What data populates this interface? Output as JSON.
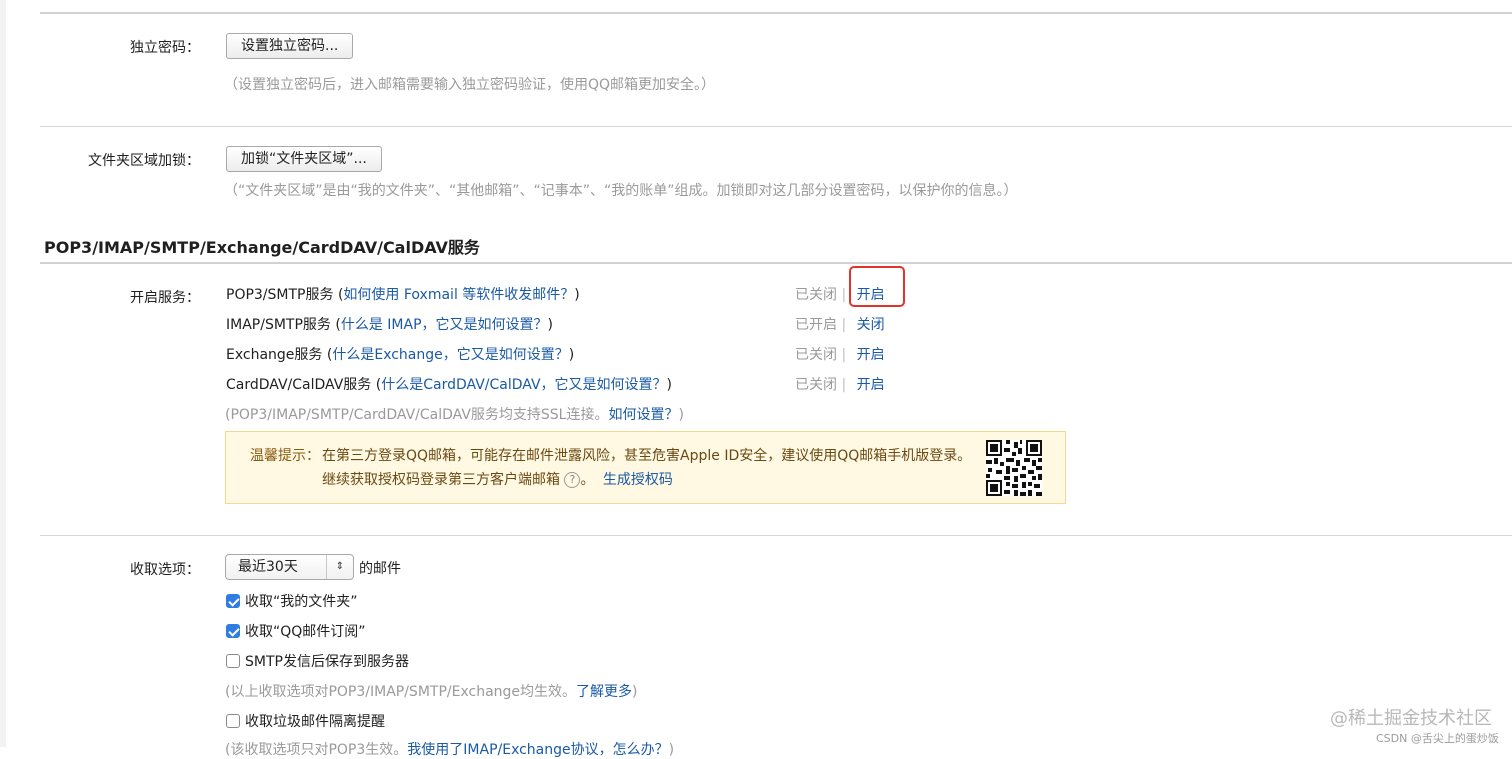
{
  "independent_password": {
    "label": "独立密码：",
    "button": "设置独立密码...",
    "hint": "（设置独立密码后，进入邮箱需要输入独立密码验证，使用QQ邮箱更加安全。）"
  },
  "folder_lock": {
    "label": "文件夹区域加锁：",
    "button": "加锁“文件夹区域”...",
    "hint": "（“文件夹区域”是由“我的文件夹”、“其他邮箱”、“记事本”、“我的账单”组成。加锁即对这几部分设置密码，以保护你的信息。）"
  },
  "services": {
    "title": "POP3/IMAP/SMTP/Exchange/CardDAV/CalDAV服务",
    "label": "开启服务：",
    "items": [
      {
        "name": "POP3/SMTP服务",
        "open_paren": " (",
        "help_link": "如何使用 Foxmail 等软件收发邮件？",
        "close_paren": ")",
        "status": "已关闭",
        "sep": "|",
        "action": "开启"
      },
      {
        "name": "IMAP/SMTP服务",
        "open_paren": " (",
        "help_link": "什么是 IMAP，它又是如何设置？",
        "close_paren": ")",
        "status": "已开启",
        "sep": "|",
        "action": "关闭"
      },
      {
        "name": "Exchange服务",
        "open_paren": " (",
        "help_link": "什么是Exchange，它又是如何设置？",
        "close_paren": ")",
        "status": "已关闭",
        "sep": "|",
        "action": "开启"
      },
      {
        "name": "CardDAV/CalDAV服务",
        "open_paren": " (",
        "help_link": "什么是CardDAV/CalDAV，它又是如何设置？",
        "close_paren": ")",
        "status": "已关闭",
        "sep": "|",
        "action": "开启"
      }
    ],
    "ssl_hint": "(POP3/IMAP/SMTP/CardDAV/CalDAV服务均支持SSL连接。",
    "ssl_link": "如何设置？",
    "ssl_close": ")"
  },
  "tip": {
    "prefix": "温馨提示：",
    "line1": "在第三方登录QQ邮箱，可能存在邮件泄露风险，甚至危害Apple ID安全，建议使用QQ邮箱手机版登录。",
    "line2": "继续获取授权码登录第三方客户端邮箱",
    "help_icon": "?",
    "line2_end": "。",
    "link": "生成授权码",
    "qr_icon": "qr-code-icon"
  },
  "receive": {
    "label": "收取选项：",
    "select_value": "最近30天",
    "select_arrow": "⇕",
    "select_suffix": "的邮件",
    "opt1": "收取“我的文件夹”",
    "opt2": "收取“QQ邮件订阅”",
    "opt3": "SMTP发信后保存到服务器",
    "hint": "(以上收取选项对POP3/IMAP/SMTP/Exchange均生效。",
    "hint_link": "了解更多",
    "hint_close": ")",
    "opt4": "收取垃圾邮件隔离提醒",
    "hint2_a": "(该收取选项只对POP3生效。",
    "hint2_link": "我使用了IMAP/Exchange协议，怎么办？",
    "hint2_close": ")"
  },
  "watermark": {
    "main": "@稀土掘金技术社区",
    "sub": "CSDN @舌尖上的蛋炒饭"
  },
  "colors": {
    "link": "#1a5aa6",
    "highlight_box": "#e0342a",
    "tip_bg": "#fff8e3",
    "checkbox": "#2f7de1"
  }
}
